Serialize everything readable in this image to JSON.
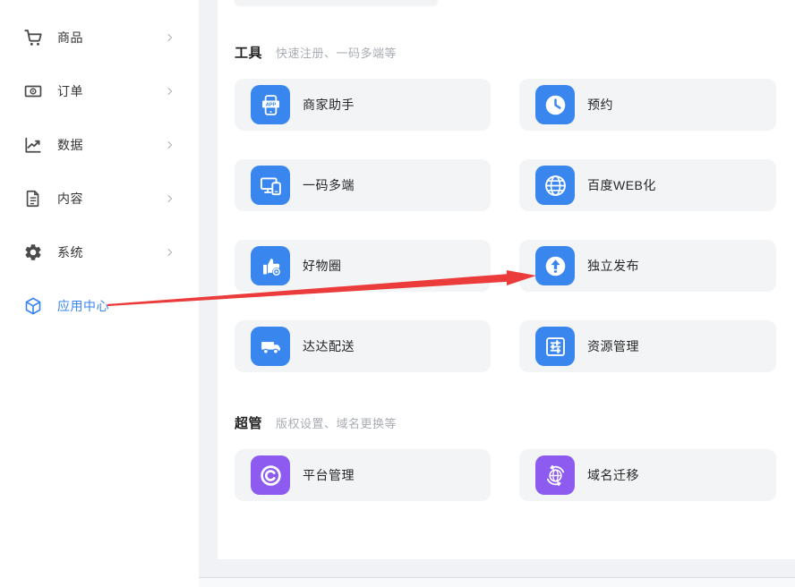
{
  "sidebar": {
    "items": [
      {
        "label": "商品",
        "icon": "cart-icon",
        "active": false,
        "has_chevron": true
      },
      {
        "label": "订单",
        "icon": "order-icon",
        "active": false,
        "has_chevron": true
      },
      {
        "label": "数据",
        "icon": "data-chart-icon",
        "active": false,
        "has_chevron": true
      },
      {
        "label": "内容",
        "icon": "content-file-icon",
        "active": false,
        "has_chevron": true
      },
      {
        "label": "系统",
        "icon": "system-gear-icon",
        "active": false,
        "has_chevron": true
      },
      {
        "label": "应用中心",
        "icon": "app-center-cube-icon",
        "active": true,
        "has_chevron": false
      }
    ]
  },
  "main": {
    "sections": [
      {
        "title": "工具",
        "subtitle": "快速注册、一码多端等",
        "cards": [
          {
            "label": "商家助手",
            "icon": "merchant-assistant-icon",
            "color": "#3a86ef"
          },
          {
            "label": "预约",
            "icon": "appointment-clock-icon",
            "color": "#3a86ef"
          },
          {
            "label": "一码多端",
            "icon": "multi-device-icon",
            "color": "#3a86ef"
          },
          {
            "label": "百度WEB化",
            "icon": "web-globe-icon",
            "color": "#3a86ef"
          },
          {
            "label": "好物圈",
            "icon": "thumbs-up-icon",
            "color": "#3a86ef"
          },
          {
            "label": "独立发布",
            "icon": "upload-publish-icon",
            "color": "#3a86ef"
          },
          {
            "label": "达达配送",
            "icon": "delivery-truck-icon",
            "color": "#3a86ef"
          },
          {
            "label": "资源管理",
            "icon": "resource-sliders-icon",
            "color": "#3a86ef"
          }
        ]
      },
      {
        "title": "超管",
        "subtitle": "版权设置、域名更换等",
        "cards": [
          {
            "label": "平台管理",
            "icon": "copyright-icon",
            "color": "#8d5bf0"
          },
          {
            "label": "域名迁移",
            "icon": "domain-migration-icon",
            "color": "#8d5bf0"
          }
        ]
      }
    ]
  },
  "annotation": {
    "arrow_color": "#ec3b3b"
  },
  "colors": {
    "accent_blue": "#3a86ef",
    "accent_purple": "#8d5bf0",
    "card_bg": "#f3f4f5",
    "page_bg": "#f0f2f5",
    "active_text": "#3a86ef"
  }
}
